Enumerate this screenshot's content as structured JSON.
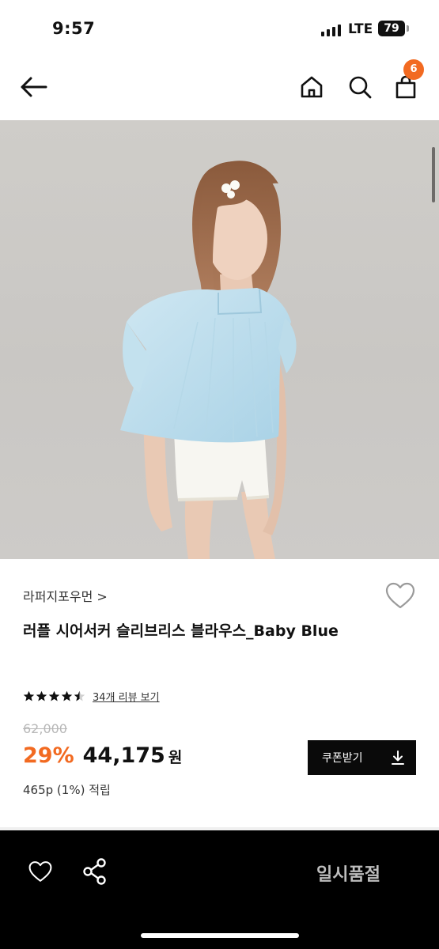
{
  "status_bar": {
    "time": "9:57",
    "network": "LTE",
    "battery": "79"
  },
  "header": {
    "cart_count": "6",
    "icons": [
      "back-arrow-icon",
      "home-icon",
      "search-icon",
      "cart-icon"
    ]
  },
  "product": {
    "brand": "라퍼지포우먼",
    "brand_chevron": ">",
    "name": "러플 시어서커 슬리브리스 블라우스_Baby Blue",
    "rating": 4.5,
    "review_link": "34개 리뷰 보기",
    "original_price": "62,000",
    "discount": "29%",
    "sale_price": "44,175",
    "currency": "원",
    "points": "465p (1%) 적립",
    "coupon_label": "쿠폰받기"
  },
  "bottom_bar": {
    "status_label": "일시품절"
  },
  "colors": {
    "accent": "#f26a21",
    "dark": "#0a0a0a",
    "muted": "#bdbdbd"
  }
}
